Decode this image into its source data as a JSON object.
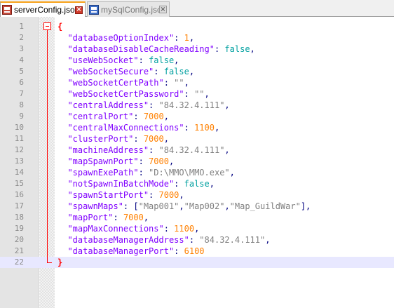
{
  "tabs": [
    {
      "label": "serverConfig.json",
      "active": true,
      "icon": "save-disk-icon-red"
    },
    {
      "label": "mySqlConfig.json",
      "active": false,
      "icon": "save-disk-icon-blue"
    }
  ],
  "colors": {
    "brace": "#ff0000",
    "key": "#8000ff",
    "string": "#808080",
    "number": "#ff8000",
    "keyword": "#00a0a0",
    "current_line": "#e8e8ff"
  },
  "editor": {
    "current_line": 22,
    "lines": [
      {
        "n": "1",
        "tokens": [
          {
            "t": "{",
            "c": "brace"
          }
        ]
      },
      {
        "n": "2",
        "tokens": [
          {
            "t": "  \"databaseOptionIndex\"",
            "c": "key"
          },
          {
            "t": ": ",
            "c": "op"
          },
          {
            "t": "1",
            "c": "num"
          },
          {
            "t": ",",
            "c": "op"
          }
        ]
      },
      {
        "n": "3",
        "tokens": [
          {
            "t": "  \"databaseDisableCacheReading\"",
            "c": "key"
          },
          {
            "t": ": ",
            "c": "op"
          },
          {
            "t": "false",
            "c": "kw"
          },
          {
            "t": ",",
            "c": "op"
          }
        ]
      },
      {
        "n": "4",
        "tokens": [
          {
            "t": "  \"useWebSocket\"",
            "c": "key"
          },
          {
            "t": ": ",
            "c": "op"
          },
          {
            "t": "false",
            "c": "kw"
          },
          {
            "t": ",",
            "c": "op"
          }
        ]
      },
      {
        "n": "5",
        "tokens": [
          {
            "t": "  \"webSocketSecure\"",
            "c": "key"
          },
          {
            "t": ": ",
            "c": "op"
          },
          {
            "t": "false",
            "c": "kw"
          },
          {
            "t": ",",
            "c": "op"
          }
        ]
      },
      {
        "n": "6",
        "tokens": [
          {
            "t": "  \"webSocketCertPath\"",
            "c": "key"
          },
          {
            "t": ": ",
            "c": "op"
          },
          {
            "t": "\"\"",
            "c": "str"
          },
          {
            "t": ",",
            "c": "op"
          }
        ]
      },
      {
        "n": "7",
        "tokens": [
          {
            "t": "  \"webSocketCertPassword\"",
            "c": "key"
          },
          {
            "t": ": ",
            "c": "op"
          },
          {
            "t": "\"\"",
            "c": "str"
          },
          {
            "t": ",",
            "c": "op"
          }
        ]
      },
      {
        "n": "8",
        "tokens": [
          {
            "t": "  \"centralAddress\"",
            "c": "key"
          },
          {
            "t": ": ",
            "c": "op"
          },
          {
            "t": "\"84.32.4.111\"",
            "c": "str"
          },
          {
            "t": ",",
            "c": "op"
          }
        ]
      },
      {
        "n": "9",
        "tokens": [
          {
            "t": "  \"centralPort\"",
            "c": "key"
          },
          {
            "t": ": ",
            "c": "op"
          },
          {
            "t": "7000",
            "c": "num"
          },
          {
            "t": ",",
            "c": "op"
          }
        ]
      },
      {
        "n": "10",
        "tokens": [
          {
            "t": "  \"centralMaxConnections\"",
            "c": "key"
          },
          {
            "t": ": ",
            "c": "op"
          },
          {
            "t": "1100",
            "c": "num"
          },
          {
            "t": ",",
            "c": "op"
          }
        ]
      },
      {
        "n": "11",
        "tokens": [
          {
            "t": "  \"clusterPort\"",
            "c": "key"
          },
          {
            "t": ": ",
            "c": "op"
          },
          {
            "t": "7000",
            "c": "num"
          },
          {
            "t": ",",
            "c": "op"
          }
        ]
      },
      {
        "n": "12",
        "tokens": [
          {
            "t": "  \"machineAddress\"",
            "c": "key"
          },
          {
            "t": ": ",
            "c": "op"
          },
          {
            "t": "\"84.32.4.111\"",
            "c": "str"
          },
          {
            "t": ",",
            "c": "op"
          }
        ]
      },
      {
        "n": "13",
        "tokens": [
          {
            "t": "  \"mapSpawnPort\"",
            "c": "key"
          },
          {
            "t": ": ",
            "c": "op"
          },
          {
            "t": "7000",
            "c": "num"
          },
          {
            "t": ",",
            "c": "op"
          }
        ]
      },
      {
        "n": "14",
        "tokens": [
          {
            "t": "  \"spawnExePath\"",
            "c": "key"
          },
          {
            "t": ": ",
            "c": "op"
          },
          {
            "t": "\"D:\\MMO\\MMO.exe\"",
            "c": "str"
          },
          {
            "t": ",",
            "c": "op"
          }
        ]
      },
      {
        "n": "15",
        "tokens": [
          {
            "t": "  \"notSpawnInBatchMode\"",
            "c": "key"
          },
          {
            "t": ": ",
            "c": "op"
          },
          {
            "t": "false",
            "c": "kw"
          },
          {
            "t": ",",
            "c": "op"
          }
        ]
      },
      {
        "n": "16",
        "tokens": [
          {
            "t": "  \"spawnStartPort\"",
            "c": "key"
          },
          {
            "t": ": ",
            "c": "op"
          },
          {
            "t": "7000",
            "c": "num"
          },
          {
            "t": ",",
            "c": "op"
          }
        ]
      },
      {
        "n": "17",
        "tokens": [
          {
            "t": "  \"spawnMaps\"",
            "c": "key"
          },
          {
            "t": ": [",
            "c": "op"
          },
          {
            "t": "\"Map001\"",
            "c": "str"
          },
          {
            "t": ",",
            "c": "op"
          },
          {
            "t": "\"Map002\"",
            "c": "str"
          },
          {
            "t": ",",
            "c": "op"
          },
          {
            "t": "\"Map_GuildWar\"",
            "c": "str"
          },
          {
            "t": "],",
            "c": "op"
          }
        ]
      },
      {
        "n": "18",
        "tokens": [
          {
            "t": "  \"mapPort\"",
            "c": "key"
          },
          {
            "t": ": ",
            "c": "op"
          },
          {
            "t": "7000",
            "c": "num"
          },
          {
            "t": ",",
            "c": "op"
          }
        ]
      },
      {
        "n": "19",
        "tokens": [
          {
            "t": "  \"mapMaxConnections\"",
            "c": "key"
          },
          {
            "t": ": ",
            "c": "op"
          },
          {
            "t": "1100",
            "c": "num"
          },
          {
            "t": ",",
            "c": "op"
          }
        ]
      },
      {
        "n": "20",
        "tokens": [
          {
            "t": "  \"databaseManagerAddress\"",
            "c": "key"
          },
          {
            "t": ": ",
            "c": "op"
          },
          {
            "t": "\"84.32.4.111\"",
            "c": "str"
          },
          {
            "t": ",",
            "c": "op"
          }
        ]
      },
      {
        "n": "21",
        "tokens": [
          {
            "t": "  \"databaseManagerPort\"",
            "c": "key"
          },
          {
            "t": ": ",
            "c": "op"
          },
          {
            "t": "6100",
            "c": "num"
          }
        ]
      },
      {
        "n": "22",
        "tokens": [
          {
            "t": "}",
            "c": "brace"
          }
        ]
      }
    ]
  }
}
